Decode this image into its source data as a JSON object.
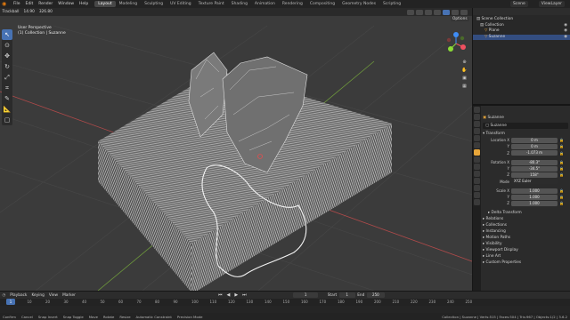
{
  "topbar": {
    "menus": [
      "File",
      "Edit",
      "Render",
      "Window",
      "Help"
    ],
    "workspace_tabs": [
      "Layout",
      "Modeling",
      "Sculpting",
      "UV Editing",
      "Texture Paint",
      "Shading",
      "Animation",
      "Rendering",
      "Compositing",
      "Geometry Nodes",
      "Scripting"
    ],
    "active_tab": "Layout",
    "scene": "Scene",
    "view_layer": "ViewLayer"
  },
  "viewport": {
    "header_items": [
      "Trackball",
      "14.90",
      "326.80"
    ],
    "overlay_line1": "User Perspective",
    "overlay_line2": "(1) Collection | Suzanne",
    "options_label": "Options",
    "gizmo": {
      "x": "X",
      "y": "Y",
      "z": "Z"
    }
  },
  "outliner": {
    "rows": [
      {
        "label": "Scene Collection",
        "indent": 0,
        "selected": false
      },
      {
        "label": "Collection",
        "indent": 1,
        "selected": false
      },
      {
        "label": "Plane",
        "indent": 2,
        "selected": false
      },
      {
        "label": "Suzanne",
        "indent": 2,
        "selected": true
      }
    ]
  },
  "properties": {
    "object_name": "Suzanne",
    "data_name": "Suzanne",
    "transform_title": "Transform",
    "location": {
      "label": "Location X",
      "x": "0 m",
      "y": "0 m",
      "z": "-1.073 m"
    },
    "rotation": {
      "label": "Rotation X",
      "x": "-80.3°",
      "y": "-34.5°",
      "z": "158°"
    },
    "mode": {
      "label": "Mode",
      "value": "XYZ Euler"
    },
    "scale": {
      "label": "Scale X",
      "x": "1.000",
      "y": "1.000",
      "z": "1.000"
    },
    "axis_y": "Y",
    "axis_z": "Z",
    "sections": [
      "Delta Transform",
      "Relations",
      "Collections",
      "Instancing",
      "Motion Paths",
      "Visibility",
      "Viewport Display",
      "Line Art",
      "Custom Properties"
    ]
  },
  "timeline": {
    "header": [
      "Playback",
      "Keying",
      "View",
      "Marker"
    ],
    "current_frame": "1",
    "start_label": "Start",
    "start": "1",
    "end_label": "End",
    "end": "250",
    "ticks": [
      "1",
      "10",
      "20",
      "30",
      "40",
      "50",
      "60",
      "70",
      "80",
      "90",
      "100",
      "110",
      "120",
      "130",
      "140",
      "150",
      "160",
      "170",
      "180",
      "190",
      "200",
      "210",
      "220",
      "230",
      "240",
      "250"
    ]
  },
  "statusbar": {
    "left": [
      "Confirm",
      "Cancel",
      "Snap Invert",
      "Snap Toggle",
      "Move",
      "Rotate",
      "Resize",
      "Automatic Constraint",
      "Precision Mode"
    ],
    "right": "Collection | Suzanne | Verts:515 | Faces:504 | Tris:967 | Objects:1/2 | 3.6.2"
  }
}
